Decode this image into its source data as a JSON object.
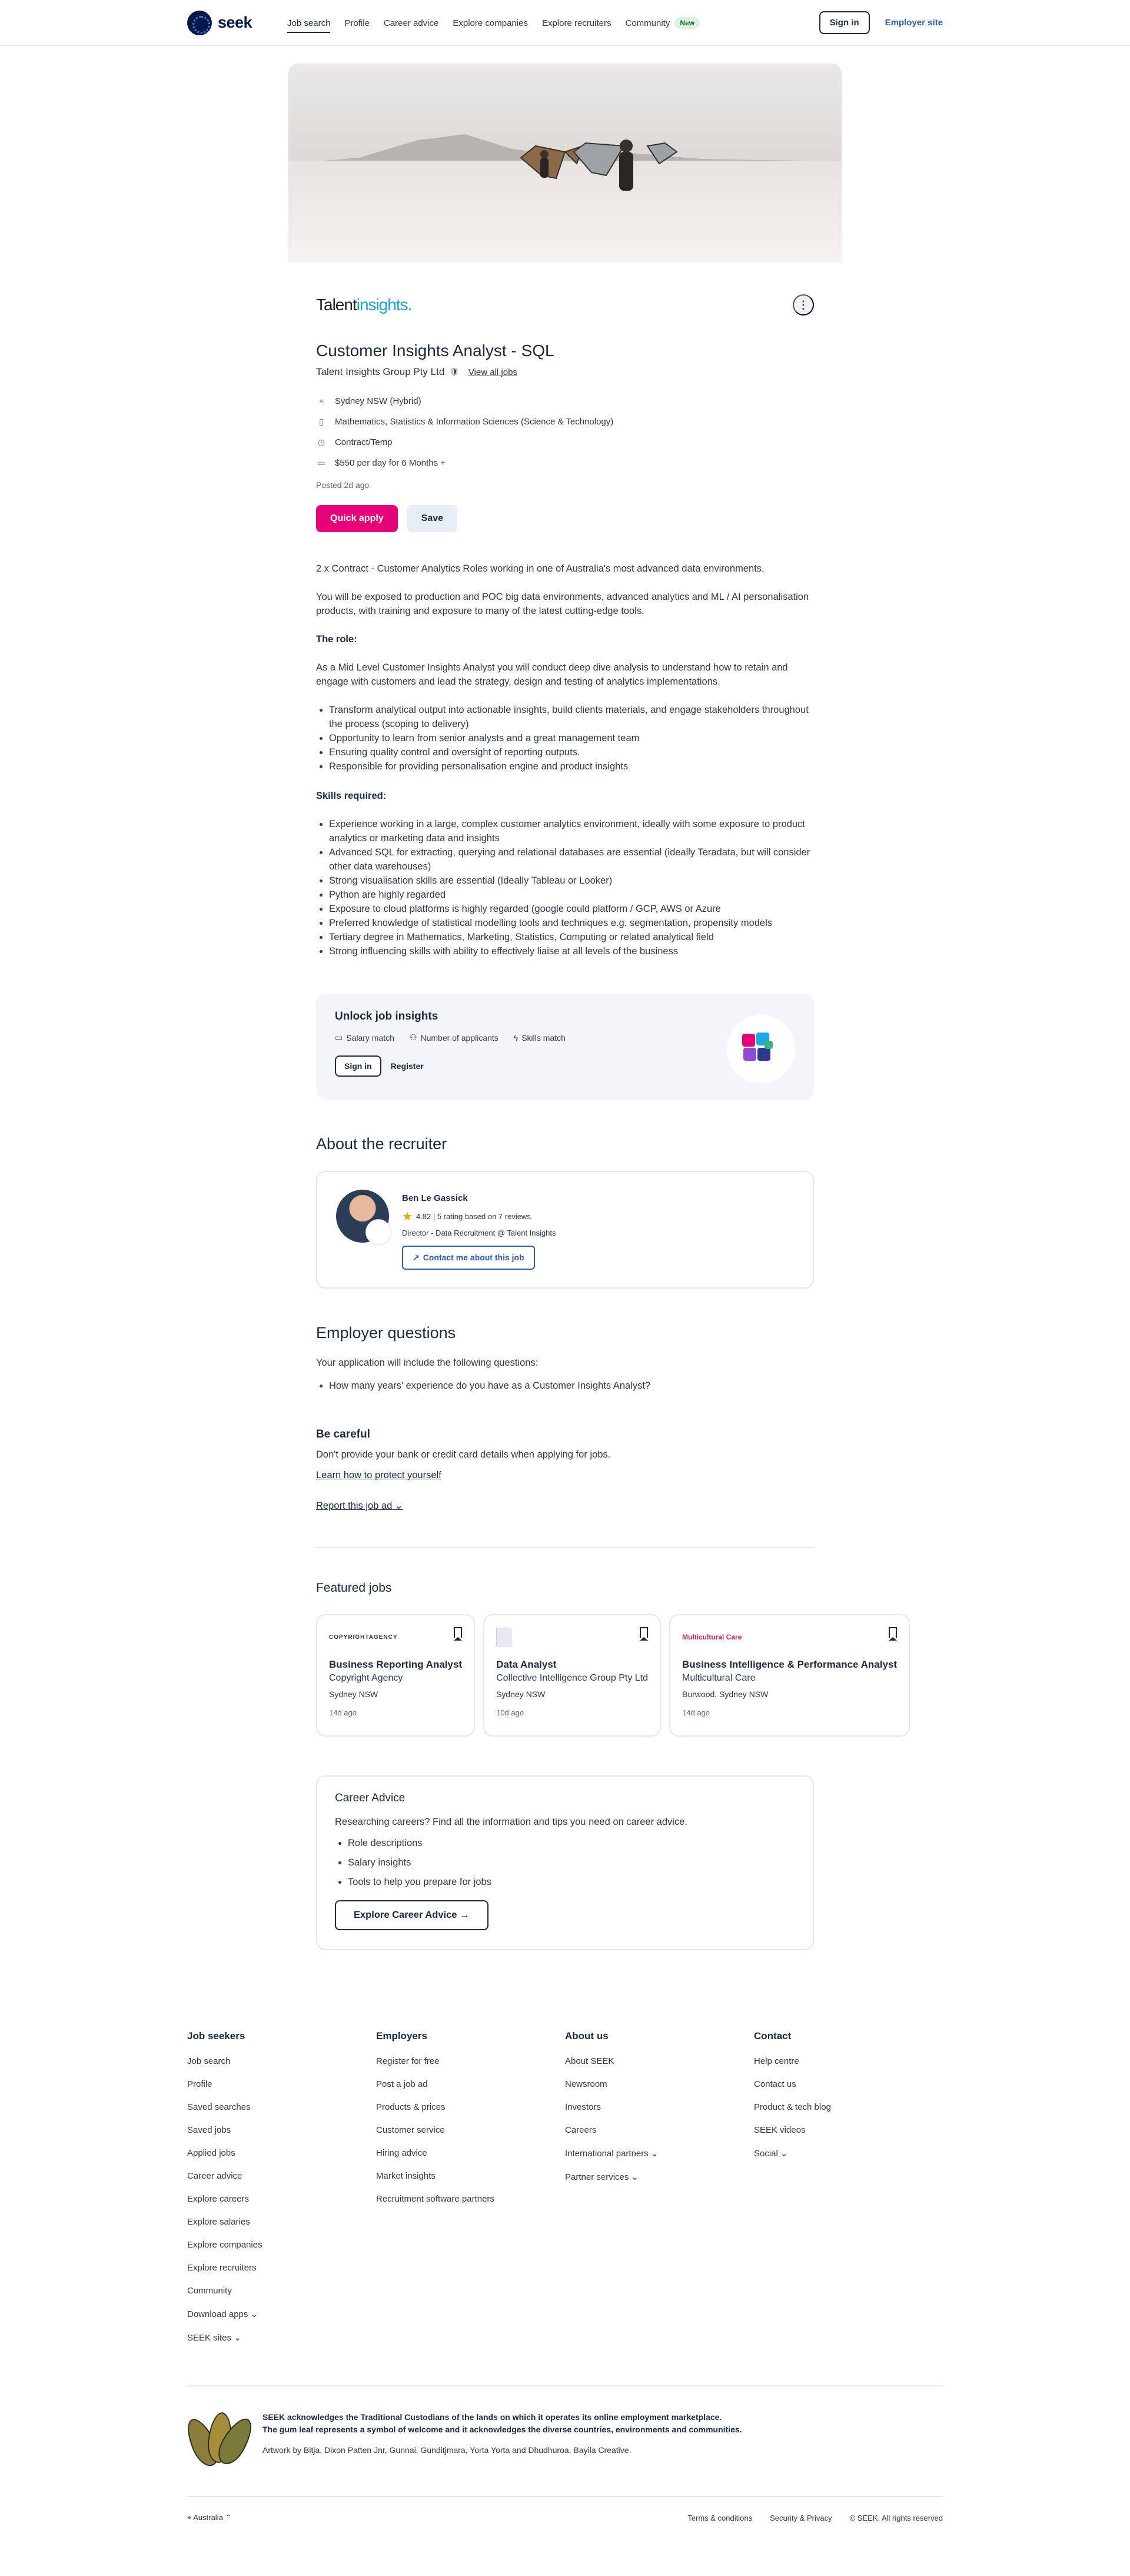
{
  "header": {
    "logo_text": "seek",
    "nav": [
      "Job search",
      "Profile",
      "Career advice",
      "Explore companies",
      "Explore recruiters",
      "Community"
    ],
    "new_badge": "New",
    "sign_in": "Sign in",
    "employer_site": "Employer site"
  },
  "company": {
    "logo_text_a": "Talent",
    "logo_text_b": "insights."
  },
  "job": {
    "title": "Customer Insights Analyst - SQL",
    "advertiser": "Talent Insights Group Pty Ltd",
    "view_all": "View all jobs",
    "location": "Sydney NSW (Hybrid)",
    "classification": "Mathematics, Statistics & Information Sciences (Science & Technology)",
    "work_type": "Contract/Temp",
    "salary": "$550 per day for 6 Months +",
    "posted": "Posted 2d ago",
    "apply": "Quick apply",
    "save": "Save"
  },
  "description": {
    "p1": "2 x Contract - Customer Analytics Roles working in one of Australia's most advanced data environments.",
    "p2": "You will be exposed to production and POC big data environments, advanced analytics and ML / AI personalisation products, with training and exposure to many of the latest cutting-edge tools.",
    "role_heading": "The role:",
    "p3": "As a Mid Level Customer Insights Analyst you will conduct deep dive analysis to understand how to retain and engage with customers and lead the strategy, design and testing of analytics implementations.",
    "role_items": [
      "Transform analytical output into actionable insights, build clients materials, and engage stakeholders throughout the process (scoping to delivery)",
      "Opportunity to learn from senior analysts and a great management team",
      "Ensuring quality control and oversight of reporting outputs.",
      "Responsible for providing personalisation engine and product insights"
    ],
    "skills_heading": "Skills required:",
    "skills_items": [
      "Experience working in a large, complex customer analytics environment, ideally with some exposure to product analytics or marketing data and insights",
      "Advanced SQL for extracting, querying and relational databases are essential (ideally Teradata, but will consider other data warehouses)",
      "Strong visualisation skills are essential (Ideally Tableau or Looker)",
      "Python are highly regarded",
      "Exposure to cloud platforms is highly regarded (google could platform / GCP, AWS or Azure",
      "Preferred knowledge of statistical modelling tools and techniques e.g. segmentation, propensity models",
      "Tertiary degree in Mathematics, Marketing, Statistics, Computing or related analytical field",
      "Strong influencing skills with ability to effectively liaise at all levels of the business"
    ]
  },
  "unlock": {
    "title": "Unlock job insights",
    "items": [
      "Salary match",
      "Number of applicants",
      "Skills match"
    ],
    "sign_in": "Sign in",
    "register": "Register"
  },
  "recruiter": {
    "heading": "About the recruiter",
    "name": "Ben Le Gassick",
    "rating": "4.82 | 5 rating based on 7 reviews",
    "role": "Director - Data Recruitment @ Talent Insights",
    "contact": "Contact me about this job"
  },
  "employer_questions": {
    "heading": "Employer questions",
    "intro": "Your application will include the following questions:",
    "items": [
      "How many years' experience do you have as a Customer Insights Analyst?"
    ]
  },
  "careful": {
    "heading": "Be careful",
    "text": "Don't provide your bank or credit card details when applying for jobs.",
    "link": "Learn how to protect yourself",
    "report": "Report this job ad"
  },
  "featured": {
    "heading": "Featured jobs",
    "jobs": [
      {
        "logo": "COPYRIGHTAGENCY",
        "title": "Business Reporting Analyst",
        "company": "Copyright Agency",
        "location": "Sydney NSW",
        "age": "14d ago"
      },
      {
        "logo": "",
        "title": "Data Analyst",
        "company": "Collective Intelligence Group Pty Ltd",
        "location": "Sydney NSW",
        "age": "10d ago"
      },
      {
        "logo": "Multicultural Care",
        "title": "Business Intelligence & Performance Analyst",
        "company": "Multicultural Care",
        "location": "Burwood, Sydney NSW",
        "age": "14d ago"
      }
    ]
  },
  "advice": {
    "heading": "Career Advice",
    "text": "Researching careers? Find all the information and tips you need on career advice.",
    "items": [
      "Role descriptions",
      "Salary insights",
      "Tools to help you prepare for jobs"
    ],
    "button": "Explore Career Advice →"
  },
  "footer": {
    "columns": [
      {
        "title": "Job seekers",
        "links": [
          "Job search",
          "Profile",
          "Saved searches",
          "Saved jobs",
          "Applied jobs",
          "Career advice",
          "Explore careers",
          "Explore salaries",
          "Explore companies",
          "Explore recruiters",
          "Community",
          "Download apps ⌄",
          "SEEK sites ⌄"
        ]
      },
      {
        "title": "Employers",
        "links": [
          "Register for free",
          "Post a job ad",
          "Products & prices",
          "Customer service",
          "Hiring advice",
          "Market insights",
          "Recruitment software partners"
        ]
      },
      {
        "title": "About us",
        "links": [
          "About SEEK",
          "Newsroom",
          "Investors",
          "Careers",
          "International partners ⌄",
          "Partner services ⌄"
        ]
      },
      {
        "title": "Contact",
        "links": [
          "Help centre",
          "Contact us",
          "Product & tech blog",
          "SEEK videos",
          "Social ⌄"
        ]
      }
    ],
    "ack_bold": "SEEK acknowledges the Traditional Custodians of the lands on which it operates its online employment marketplace.",
    "ack_bold2": "The gum leaf represents a symbol of welcome and it acknowledges the diverse countries, environments and communities.",
    "ack_art": "Artwork by Bitja, Dixon Patten Jnr, Gunnai, Gunditjmara, Yorta Yorta and Dhudhuroa, Bayila Creative.",
    "country": "Australia",
    "terms": "Terms & conditions",
    "security": "Security & Privacy",
    "copyright": "© SEEK. All rights reserved"
  }
}
